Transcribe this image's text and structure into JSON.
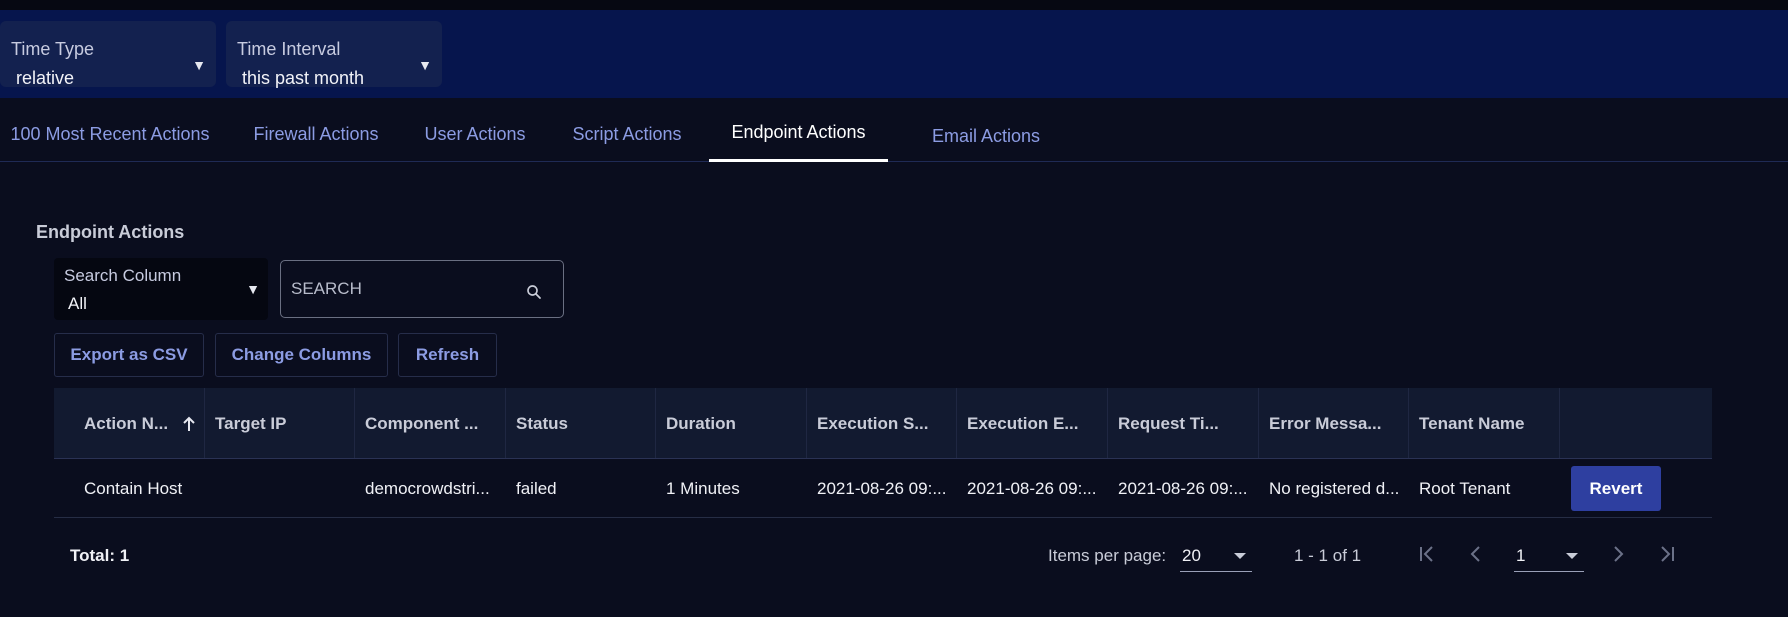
{
  "filters": {
    "time_type": {
      "label": "Time Type",
      "value": "relative"
    },
    "time_interval": {
      "label": "Time Interval",
      "value": "this past month"
    }
  },
  "tabs": [
    {
      "label": "100 Most Recent Actions",
      "active": false
    },
    {
      "label": "Firewall Actions",
      "active": false
    },
    {
      "label": "User Actions",
      "active": false
    },
    {
      "label": "Script Actions",
      "active": false
    },
    {
      "label": "Endpoint Actions",
      "active": true
    },
    {
      "label": "Email Actions",
      "active": false
    }
  ],
  "section": {
    "title": "Endpoint Actions",
    "search_column": {
      "label": "Search Column",
      "value": "All"
    },
    "search": {
      "placeholder": "SEARCH",
      "icon": "search-icon"
    }
  },
  "toolbar": {
    "export_label": "Export as CSV",
    "columns_label": "Change Columns",
    "refresh_label": "Refresh"
  },
  "table": {
    "columns": [
      "Action N...",
      "Target IP",
      "Component ...",
      "Status",
      "Duration",
      "Execution S...",
      "Execution E...",
      "Request Ti...",
      "Error Messa...",
      "Tenant Name",
      ""
    ],
    "sort_icon": "arrow-up-icon",
    "rows": [
      {
        "cells": [
          "Contain Host",
          "",
          "democrowdstri...",
          "failed",
          "1 Minutes",
          "2021-08-26 09:...",
          "2021-08-26 09:...",
          "2021-08-26 09:...",
          "No registered d...",
          "Root Tenant"
        ],
        "action_label": "Revert"
      }
    ]
  },
  "footer": {
    "total": "Total: 1",
    "items_per_page_label": "Items per page:",
    "items_per_page": "20",
    "range": "1 - 1 of 1",
    "page": "1"
  },
  "colors": {
    "background": "#0a0d1e",
    "filter_bar": "#06154d",
    "accent": "#8c9ce3",
    "primary_button": "#2e3fa0"
  }
}
